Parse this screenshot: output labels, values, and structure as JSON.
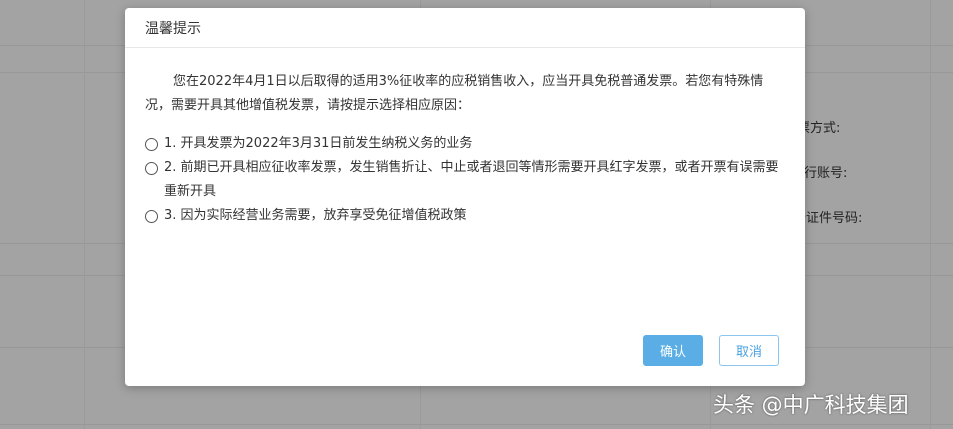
{
  "background": {
    "labels": [
      "票方式:",
      "行账号:",
      "份证件号码:"
    ]
  },
  "dialog": {
    "title": "温馨提示",
    "intro": "您在2022年4月1日以后取得的适用3%征收率的应税销售收入，应当开具免税普通发票。若您有特殊情况，需要开具其他增值税发票，请按提示选择相应原因：",
    "options": [
      "1. 开具发票为2022年3月31日前发生纳税义务的业务",
      "2. 前期已开具相应征收率发票，发生销售折让、中止或者退回等情形需要开具红字发票，或者开票有误需要重新开具",
      "3. 因为实际经营业务需要，放弃享受免征增值税政策"
    ],
    "confirm_label": "确认",
    "cancel_label": "取消"
  },
  "watermark": "头条 @中广科技集团"
}
